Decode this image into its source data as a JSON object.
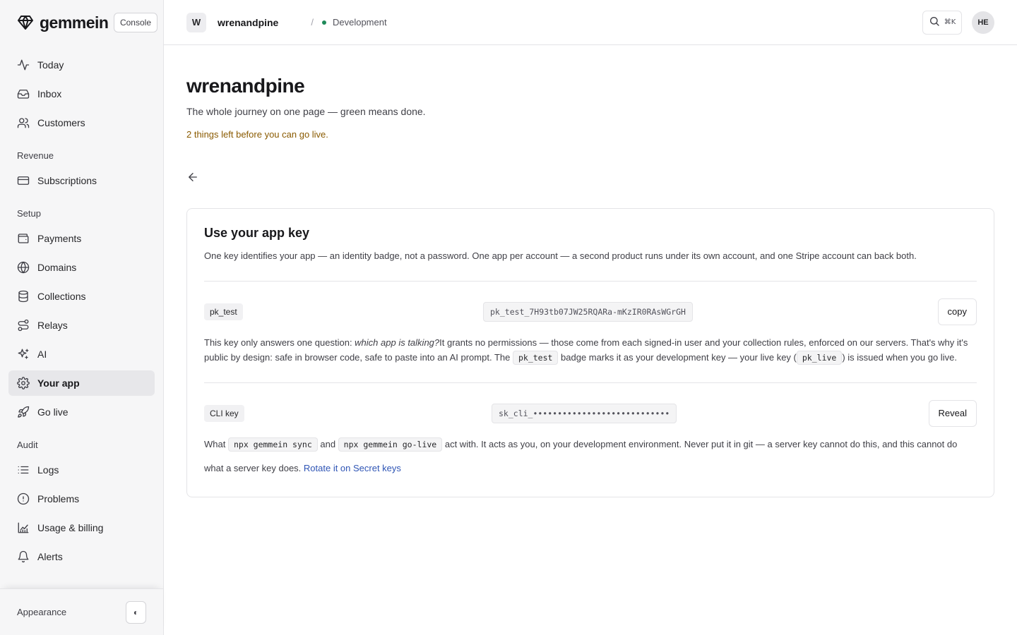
{
  "brand": {
    "name": "gemmein",
    "console_label": "Console"
  },
  "sidebar": {
    "primary": [
      {
        "label": "Today",
        "icon": "activity-icon"
      },
      {
        "label": "Inbox",
        "icon": "inbox-icon"
      },
      {
        "label": "Customers",
        "icon": "users-icon"
      }
    ],
    "sections": [
      {
        "title": "Revenue",
        "items": [
          {
            "label": "Subscriptions",
            "icon": "credit-card-icon"
          }
        ]
      },
      {
        "title": "Setup",
        "items": [
          {
            "label": "Payments",
            "icon": "wallet-icon"
          },
          {
            "label": "Domains",
            "icon": "globe-icon"
          },
          {
            "label": "Collections",
            "icon": "database-icon"
          },
          {
            "label": "Relays",
            "icon": "route-icon"
          },
          {
            "label": "AI",
            "icon": "sparkles-icon"
          },
          {
            "label": "Your app",
            "icon": "gear-icon",
            "active": true
          },
          {
            "label": "Go live",
            "icon": "rocket-icon"
          }
        ]
      },
      {
        "title": "Audit",
        "items": [
          {
            "label": "Logs",
            "icon": "list-icon"
          },
          {
            "label": "Problems",
            "icon": "alert-circle-icon"
          },
          {
            "label": "Usage & billing",
            "icon": "chart-icon"
          },
          {
            "label": "Alerts",
            "icon": "bell-icon"
          }
        ]
      }
    ],
    "footer": {
      "appearance_label": "Appearance",
      "toggle_glyph": "◐"
    }
  },
  "topbar": {
    "app_initial": "W",
    "app_name": "wrenandpine",
    "separator": "/",
    "environment": "Development",
    "environment_color": "#1f8a5a",
    "search_shortcut": "⌘K",
    "user_initials": "HE"
  },
  "page": {
    "title": "wrenandpine",
    "subtitle": "The whole journey on one page — green means done.",
    "warning": "2 things left before you can go live."
  },
  "card": {
    "title": "Use your app key",
    "description": "One key identifies your app — an identity badge, not a password. One app per account — a second product runs under its own account, and one Stripe account can back both.",
    "publishable": {
      "badge": "pk_test",
      "value": "pk_test_7H93tb07JW25RQARa-mKzIR0RAsWGrGH",
      "action": "copy",
      "note_1": "This key only answers one question: ",
      "note_em": "which app is talking?",
      "note_2": "It grants no permissions — those come from each signed-in user and your collection rules, enforced on our servers. That's why it's public by design: safe in browser code, safe to paste into an AI prompt. The ",
      "note_code_1": "pk_test",
      "note_3": " badge marks it as your development key — your live key (",
      "note_code_2": "pk_live",
      "note_4": ") is issued when you go live."
    },
    "cli": {
      "badge": "CLI key",
      "value": "sk_cli_••••••••••••••••••••••••••••",
      "action": "Reveal",
      "note_1": "What ",
      "note_code_1": "npx gemmein sync",
      "note_2": " and ",
      "note_code_2": "npx gemmein go-live",
      "note_3": " act with. It acts as you, on your development environment. Never put it in git — a server key cannot do this, and this cannot do what a server key does. ",
      "note_link": "Rotate it on Secret keys"
    }
  }
}
